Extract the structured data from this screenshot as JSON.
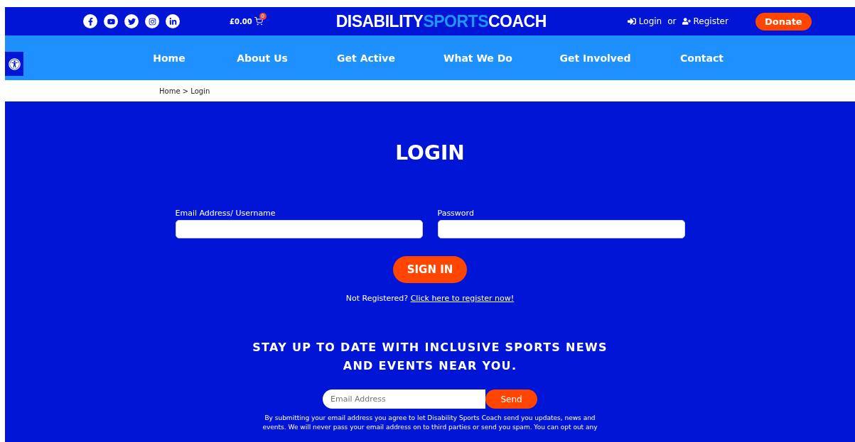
{
  "header": {
    "social": [
      {
        "kind": "facebook"
      },
      {
        "kind": "youtube"
      },
      {
        "kind": "twitter"
      },
      {
        "kind": "instagram"
      },
      {
        "kind": "linkedin"
      }
    ],
    "cart": {
      "total": "£0.00",
      "count": "0"
    },
    "logo": [
      {
        "text": "DISABILITY",
        "accent": false
      },
      {
        "text": "SPORTS",
        "accent": true
      },
      {
        "text": "COACH",
        "accent": false
      }
    ],
    "login": "Login",
    "or": "or",
    "register": "Register",
    "donate": "Donate"
  },
  "nav": [
    {
      "label": "Home"
    },
    {
      "label": "About Us"
    },
    {
      "label": "Get Active"
    },
    {
      "label": "What We Do"
    },
    {
      "label": "Get Involved"
    },
    {
      "label": "Contact"
    }
  ],
  "breadcrumb": "Home > Login",
  "login_form": {
    "title": "LOGIN",
    "fields": [
      {
        "label": "Email Address/ Username"
      },
      {
        "label": "Password"
      }
    ],
    "submit": "SIGN IN",
    "prompt": "Not Registered?",
    "register_link": "Click here to register now!"
  },
  "newsletter": {
    "heading": "STAY UP TO DATE WITH INCLUSIVE SPORTS NEWS AND EVENTS NEAR YOU.",
    "placeholder": "Email Address",
    "send": "Send",
    "disclaimer": "By submitting your email address you agree to let Disability Sports Coach send you updates, news and events. We will never pass your email address on to third parties or send you spam. You can opt out any"
  }
}
